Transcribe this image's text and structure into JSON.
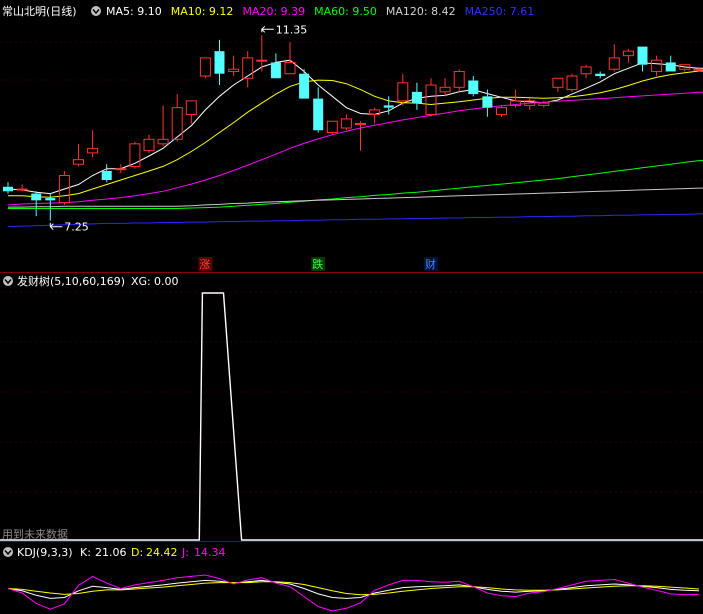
{
  "header": {
    "stock_name": "常山北明(日线)",
    "ma": [
      {
        "label": "MA5:",
        "value": "9.10",
        "color": "#ffffff"
      },
      {
        "label": "MA10:",
        "value": "9.12",
        "color": "#ffff00"
      },
      {
        "label": "MA20:",
        "value": "9.39",
        "color": "#ff00ff"
      },
      {
        "label": "MA60:",
        "value": "9.50",
        "color": "#00ff00"
      },
      {
        "label": "MA120:",
        "value": "8.42",
        "color": "#d0d0d0"
      },
      {
        "label": "MA250:",
        "value": "7.61",
        "color": "#3030ff"
      }
    ]
  },
  "annotations": {
    "high": "11.35",
    "low": "7.25"
  },
  "markers": [
    {
      "text": "涨",
      "color": "#ff4040",
      "bg": "#5a0000",
      "index": 14
    },
    {
      "text": "跌",
      "color": "#40ff40",
      "bg": "#003a00",
      "index": 22
    },
    {
      "text": "财",
      "color": "#4080ff",
      "bg": "#00103a",
      "index": 30
    }
  ],
  "indicator1": {
    "title": "发财树(5,10,60,169)",
    "xg_label": "XG:",
    "xg_value": "0.00",
    "watermark": "用到未来数据"
  },
  "indicator2": {
    "title": "KDJ(9,3,3)",
    "k_label": "K:",
    "k_value": "21.06",
    "d_label": "D:",
    "d_value": "24.42",
    "j_label": "J:",
    "j_value": "14.34"
  },
  "colors": {
    "up": "#ff3232",
    "down": "#54ffff",
    "panel_border": "#8b0000",
    "kdj_k": "#ffffff",
    "kdj_d": "#ffff00",
    "kdj_j": "#ff00ff"
  },
  "chart_data": [
    {
      "type": "candlestick",
      "ylim": [
        7.0,
        11.6
      ],
      "candles": [
        {
          "o": 8.0,
          "h": 8.1,
          "l": 7.85,
          "c": 7.9
        },
        {
          "o": 7.95,
          "h": 8.05,
          "l": 7.9,
          "c": 7.95
        },
        {
          "o": 7.85,
          "h": 7.9,
          "l": 7.35,
          "c": 7.7
        },
        {
          "o": 7.75,
          "h": 7.85,
          "l": 7.25,
          "c": 7.7
        },
        {
          "o": 7.65,
          "h": 8.35,
          "l": 7.6,
          "c": 8.25
        },
        {
          "o": 8.5,
          "h": 8.95,
          "l": 8.45,
          "c": 8.6
        },
        {
          "o": 8.75,
          "h": 9.25,
          "l": 8.65,
          "c": 8.85
        },
        {
          "o": 8.35,
          "h": 8.5,
          "l": 8.1,
          "c": 8.15
        },
        {
          "o": 8.4,
          "h": 8.5,
          "l": 8.3,
          "c": 8.4
        },
        {
          "o": 8.45,
          "h": 9.0,
          "l": 8.4,
          "c": 8.95
        },
        {
          "o": 8.8,
          "h": 9.15,
          "l": 8.75,
          "c": 9.05
        },
        {
          "o": 8.95,
          "h": 9.8,
          "l": 8.9,
          "c": 9.05
        },
        {
          "o": 9.05,
          "h": 10.05,
          "l": 9.0,
          "c": 9.75
        },
        {
          "o": 9.6,
          "h": 9.9,
          "l": 9.4,
          "c": 9.9
        },
        {
          "o": 10.45,
          "h": 10.85,
          "l": 10.4,
          "c": 10.85
        },
        {
          "o": 11.0,
          "h": 11.25,
          "l": 10.25,
          "c": 10.5
        },
        {
          "o": 10.55,
          "h": 10.9,
          "l": 10.45,
          "c": 10.6
        },
        {
          "o": 10.4,
          "h": 11.0,
          "l": 10.2,
          "c": 10.85
        },
        {
          "o": 10.8,
          "h": 11.35,
          "l": 10.55,
          "c": 10.8
        },
        {
          "o": 10.75,
          "h": 10.95,
          "l": 10.4,
          "c": 10.4
        },
        {
          "o": 10.5,
          "h": 11.2,
          "l": 10.5,
          "c": 10.75
        },
        {
          "o": 10.5,
          "h": 10.6,
          "l": 9.95,
          "c": 9.95
        },
        {
          "o": 9.95,
          "h": 10.2,
          "l": 9.2,
          "c": 9.25
        },
        {
          "o": 9.2,
          "h": 9.45,
          "l": 9.15,
          "c": 9.45
        },
        {
          "o": 9.3,
          "h": 9.6,
          "l": 9.25,
          "c": 9.5
        },
        {
          "o": 9.4,
          "h": 9.45,
          "l": 8.8,
          "c": 9.4
        },
        {
          "o": 9.6,
          "h": 9.75,
          "l": 9.4,
          "c": 9.7
        },
        {
          "o": 9.8,
          "h": 10.0,
          "l": 9.6,
          "c": 9.75
        },
        {
          "o": 9.9,
          "h": 10.5,
          "l": 9.8,
          "c": 10.3
        },
        {
          "o": 10.1,
          "h": 10.3,
          "l": 9.7,
          "c": 9.85
        },
        {
          "o": 9.6,
          "h": 10.4,
          "l": 9.55,
          "c": 10.25
        },
        {
          "o": 10.1,
          "h": 10.4,
          "l": 10.0,
          "c": 10.2
        },
        {
          "o": 10.2,
          "h": 10.6,
          "l": 10.1,
          "c": 10.55
        },
        {
          "o": 10.35,
          "h": 10.45,
          "l": 10.0,
          "c": 10.05
        },
        {
          "o": 10.0,
          "h": 10.15,
          "l": 9.55,
          "c": 9.75
        },
        {
          "o": 9.6,
          "h": 9.8,
          "l": 9.55,
          "c": 9.75
        },
        {
          "o": 9.8,
          "h": 10.15,
          "l": 9.75,
          "c": 9.9
        },
        {
          "o": 9.8,
          "h": 9.95,
          "l": 9.7,
          "c": 9.9
        },
        {
          "o": 9.8,
          "h": 9.9,
          "l": 9.75,
          "c": 9.85
        },
        {
          "o": 10.2,
          "h": 10.4,
          "l": 10.1,
          "c": 10.4
        },
        {
          "o": 10.15,
          "h": 10.5,
          "l": 10.1,
          "c": 10.45
        },
        {
          "o": 10.5,
          "h": 10.7,
          "l": 10.4,
          "c": 10.65
        },
        {
          "o": 10.5,
          "h": 10.55,
          "l": 10.4,
          "c": 10.45
        },
        {
          "o": 10.6,
          "h": 11.15,
          "l": 10.55,
          "c": 10.85
        },
        {
          "o": 10.9,
          "h": 11.05,
          "l": 10.75,
          "c": 11.0
        },
        {
          "o": 11.1,
          "h": 11.1,
          "l": 10.55,
          "c": 10.7
        },
        {
          "o": 10.55,
          "h": 10.9,
          "l": 10.45,
          "c": 10.8
        },
        {
          "o": 10.75,
          "h": 10.9,
          "l": 10.55,
          "c": 10.55
        },
        {
          "o": 10.6,
          "h": 10.7,
          "l": 10.55,
          "c": 10.7
        },
        {
          "o": 10.6,
          "h": 10.65,
          "l": 10.55,
          "c": 10.6
        }
      ],
      "ma_lines": {
        "ma5": [
          7.95,
          7.93,
          7.88,
          7.85,
          7.95,
          8.05,
          8.25,
          8.4,
          8.4,
          8.52,
          8.68,
          8.85,
          9.1,
          9.35,
          9.7,
          10.0,
          10.25,
          10.45,
          10.65,
          10.75,
          10.8,
          10.55,
          10.25,
          10.0,
          9.75,
          9.62,
          9.6,
          9.68,
          9.85,
          9.96,
          10.0,
          10.02,
          10.1,
          10.15,
          10.06,
          9.98,
          9.9,
          9.88,
          9.86,
          9.92,
          10.05,
          10.18,
          10.32,
          10.5,
          10.62,
          10.74,
          10.72,
          10.7,
          10.65,
          10.62
        ],
        "ma10": [
          7.8,
          7.8,
          7.78,
          7.77,
          7.8,
          7.85,
          7.95,
          8.05,
          8.15,
          8.25,
          8.35,
          8.45,
          8.6,
          8.78,
          8.98,
          9.2,
          9.42,
          9.65,
          9.85,
          10.05,
          10.22,
          10.32,
          10.36,
          10.35,
          10.28,
          10.15,
          10.0,
          9.9,
          9.86,
          9.85,
          9.82,
          9.85,
          9.88,
          9.92,
          9.96,
          9.98,
          9.98,
          9.97,
          9.96,
          9.97,
          9.99,
          10.03,
          10.08,
          10.15,
          10.24,
          10.34,
          10.42,
          10.48,
          10.52,
          10.56
        ],
        "ma20": [
          7.6,
          7.62,
          7.63,
          7.64,
          7.65,
          7.67,
          7.7,
          7.73,
          7.76,
          7.8,
          7.85,
          7.9,
          7.98,
          8.06,
          8.15,
          8.25,
          8.36,
          8.48,
          8.6,
          8.72,
          8.85,
          8.96,
          9.06,
          9.15,
          9.23,
          9.3,
          9.36,
          9.42,
          9.48,
          9.53,
          9.58,
          9.63,
          9.68,
          9.72,
          9.76,
          9.79,
          9.82,
          9.85,
          9.87,
          9.89,
          9.91,
          9.93,
          9.95,
          9.97,
          9.99,
          10.01,
          10.03,
          10.05,
          10.07,
          10.09
        ],
        "ma60": [
          7.52,
          7.52,
          7.52,
          7.52,
          7.52,
          7.52,
          7.52,
          7.52,
          7.52,
          7.52,
          7.52,
          7.52,
          7.52,
          7.53,
          7.54,
          7.55,
          7.57,
          7.59,
          7.61,
          7.63,
          7.66,
          7.68,
          7.71,
          7.73,
          7.76,
          7.78,
          7.81,
          7.83,
          7.86,
          7.88,
          7.91,
          7.94,
          7.97,
          8.0,
          8.03,
          8.06,
          8.09,
          8.12,
          8.15,
          8.18,
          8.22,
          8.26,
          8.3,
          8.34,
          8.38,
          8.42,
          8.46,
          8.5,
          8.54,
          8.58
        ],
        "ma120": [
          7.55,
          7.55,
          7.56,
          7.56,
          7.57,
          7.57,
          7.57,
          7.57,
          7.57,
          7.57,
          7.57,
          7.57,
          7.57,
          7.58,
          7.6,
          7.61,
          7.63,
          7.64,
          7.66,
          7.67,
          7.68,
          7.69,
          7.7,
          7.71,
          7.72,
          7.73,
          7.74,
          7.75,
          7.76,
          7.77,
          7.78,
          7.79,
          7.8,
          7.81,
          7.82,
          7.83,
          7.84,
          7.85,
          7.86,
          7.87,
          7.88,
          7.89,
          7.9,
          7.91,
          7.92,
          7.93,
          7.94,
          7.95,
          7.96,
          7.97
        ],
        "ma250": [
          7.12,
          7.13,
          7.14,
          7.15,
          7.16,
          7.17,
          7.18,
          7.19,
          7.19,
          7.2,
          7.2,
          7.21,
          7.21,
          7.22,
          7.22,
          7.23,
          7.23,
          7.24,
          7.24,
          7.25,
          7.25,
          7.26,
          7.26,
          7.27,
          7.27,
          7.28,
          7.28,
          7.29,
          7.29,
          7.3,
          7.3,
          7.31,
          7.31,
          7.32,
          7.32,
          7.33,
          7.33,
          7.34,
          7.34,
          7.35,
          7.35,
          7.36,
          7.36,
          7.37,
          7.37,
          7.38,
          7.38,
          7.39,
          7.39,
          7.4
        ]
      }
    },
    {
      "type": "line",
      "series": [
        {
          "values": [
            0,
            0,
            0,
            0,
            0,
            0,
            0,
            0,
            0,
            0,
            0,
            0,
            0,
            0,
            1,
            1,
            0,
            0,
            0,
            0,
            0,
            0,
            0,
            0,
            0,
            0,
            0,
            0,
            0,
            0,
            0,
            0,
            0,
            0,
            0,
            0,
            0,
            0,
            0,
            0,
            0,
            0,
            0,
            0,
            0,
            0,
            0,
            0,
            0,
            0
          ]
        }
      ],
      "ylim": [
        0,
        1
      ]
    },
    {
      "type": "line",
      "ylim": [
        0,
        100
      ],
      "series": [
        {
          "name": "K",
          "values": [
            50,
            45,
            35,
            28,
            30,
            45,
            55,
            52,
            48,
            52,
            55,
            58,
            62,
            65,
            68,
            66,
            62,
            65,
            68,
            64,
            60,
            50,
            38,
            30,
            28,
            30,
            40,
            46,
            52,
            54,
            55,
            56,
            58,
            54,
            48,
            44,
            42,
            44,
            45,
            48,
            52,
            56,
            58,
            60,
            58,
            55,
            52,
            48,
            46,
            45
          ]
        },
        {
          "name": "D",
          "values": [
            50,
            48,
            44,
            40,
            37,
            39,
            44,
            47,
            47,
            49,
            51,
            53,
            56,
            59,
            62,
            63,
            63,
            63,
            65,
            65,
            63,
            59,
            52,
            45,
            39,
            36,
            37,
            40,
            44,
            47,
            50,
            52,
            54,
            54,
            52,
            49,
            47,
            46,
            46,
            47,
            49,
            51,
            53,
            55,
            56,
            56,
            55,
            53,
            51,
            49
          ]
        },
        {
          "name": "J",
          "values": [
            50,
            40,
            17,
            4,
            16,
            57,
            77,
            62,
            50,
            58,
            63,
            68,
            74,
            77,
            80,
            72,
            60,
            69,
            74,
            62,
            54,
            32,
            10,
            0,
            6,
            18,
            46,
            58,
            68,
            68,
            65,
            64,
            66,
            54,
            40,
            34,
            32,
            40,
            43,
            50,
            58,
            66,
            68,
            70,
            62,
            53,
            46,
            38,
            36,
            37
          ]
        }
      ]
    }
  ]
}
